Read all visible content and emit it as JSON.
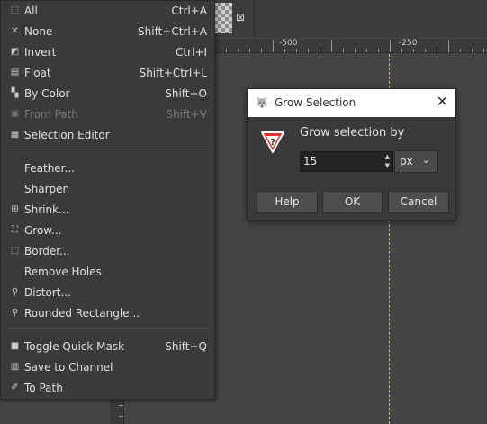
{
  "menu": {
    "items": [
      {
        "label": "All",
        "accel": "Ctrl+A",
        "icon": "select-all-icon",
        "glyph": "⬚"
      },
      {
        "label": "None",
        "accel": "Shift+Ctrl+A",
        "icon": "select-none-icon",
        "glyph": "✕"
      },
      {
        "label": "Invert",
        "accel": "Ctrl+I",
        "icon": "invert-icon",
        "glyph": "◩"
      },
      {
        "label": "Float",
        "accel": "Shift+Ctrl+L",
        "icon": "float-icon",
        "glyph": "▤"
      },
      {
        "label": "By Color",
        "accel": "Shift+O",
        "icon": "by-color-icon",
        "glyph": "▚"
      },
      {
        "label": "From Path",
        "accel": "Shift+V",
        "icon": "from-path-icon",
        "glyph": "▣",
        "disabled": true
      },
      {
        "label": "Selection Editor",
        "accel": "",
        "icon": "selection-editor-icon",
        "glyph": "▦"
      },
      {
        "label": "Feather...",
        "accel": "",
        "icon": "",
        "glyph": ""
      },
      {
        "label": "Sharpen",
        "accel": "",
        "icon": "",
        "glyph": ""
      },
      {
        "label": "Shrink...",
        "accel": "",
        "icon": "shrink-icon",
        "glyph": "⊞"
      },
      {
        "label": "Grow...",
        "accel": "",
        "icon": "grow-icon",
        "glyph": "⛶"
      },
      {
        "label": "Border...",
        "accel": "",
        "icon": "border-icon",
        "glyph": "⬚"
      },
      {
        "label": "Remove Holes",
        "accel": "",
        "icon": "",
        "glyph": ""
      },
      {
        "label": "Distort...",
        "accel": "",
        "icon": "distort-icon",
        "glyph": "⚲"
      },
      {
        "label": "Rounded Rectangle...",
        "accel": "",
        "icon": "rounded-rectangle-icon",
        "glyph": "⚲"
      },
      {
        "label": "Toggle Quick Mask",
        "accel": "Shift+Q",
        "icon": "quick-mask-icon",
        "glyph": "■"
      },
      {
        "label": "Save to Channel",
        "accel": "",
        "icon": "save-channel-icon",
        "glyph": "▥"
      },
      {
        "label": "To Path",
        "accel": "",
        "icon": "to-path-icon",
        "glyph": "✐"
      }
    ]
  },
  "ruler": {
    "labels": [
      "-500",
      "-250"
    ]
  },
  "dialog": {
    "title": "Grow Selection",
    "prompt": "Grow selection by",
    "value": "15",
    "unit": "px",
    "help": "Help",
    "ok": "OK",
    "cancel": "Cancel"
  },
  "colors": {
    "accent_warning": "#e0332b",
    "menu_bg": "#3a3a3a",
    "canvas_bg": "#454545"
  }
}
